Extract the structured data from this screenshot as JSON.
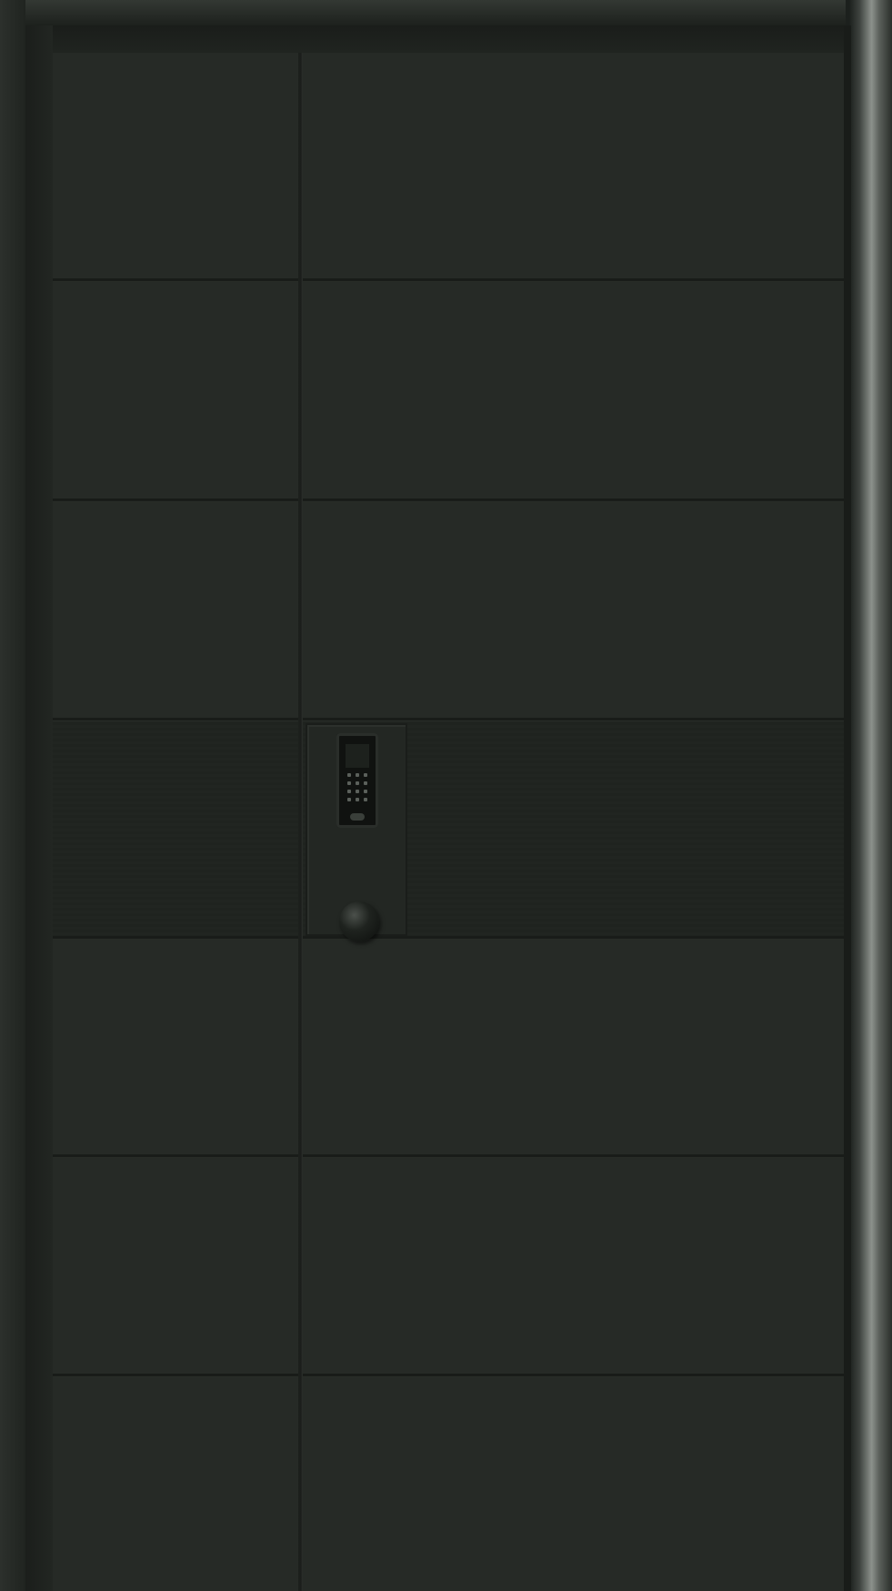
{
  "scene": {
    "subject": "door",
    "colors": {
      "panel": "#262a26",
      "frame": "#1f2320",
      "frame_highlight": "#8c918c",
      "groove": "#1a1d1a",
      "hardware": "#101210"
    },
    "panel_rows": 7,
    "panel_columns": 2,
    "lock": {
      "type": "keypad",
      "has_knob": true
    }
  }
}
